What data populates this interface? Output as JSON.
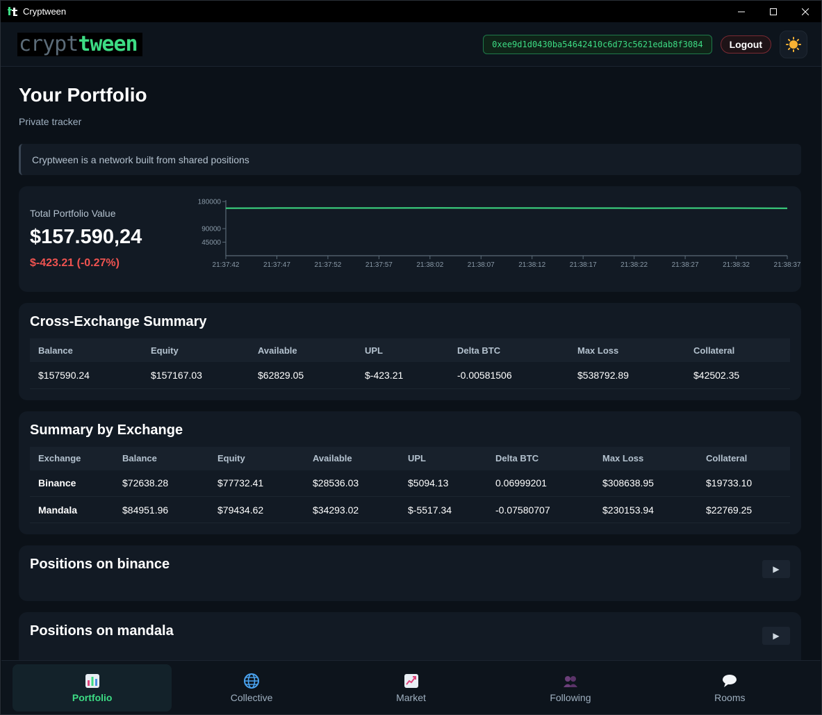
{
  "window": {
    "title": "Cryptween",
    "minimize": "—",
    "maximize": "☐",
    "close": "✕"
  },
  "header": {
    "logo_part1": "crypt",
    "logo_part2": "tween",
    "wallet": "0xee9d1d0430ba54642410c6d73c5621edab8f3084",
    "logout": "Logout"
  },
  "page": {
    "title": "Your Portfolio",
    "subtitle": "Private tracker",
    "banner": "Cryptween is a network built from shared positions"
  },
  "portfolio": {
    "label": "Total Portfolio Value",
    "value": "$157.590,24",
    "change": "$-423.21 (-0.27%)"
  },
  "chart_data": {
    "type": "line",
    "x": [
      "21:37:42",
      "21:37:47",
      "21:37:52",
      "21:37:57",
      "21:38:02",
      "21:38:07",
      "21:38:12",
      "21:38:17",
      "21:38:22",
      "21:38:27",
      "21:38:32",
      "21:38:37"
    ],
    "series": [
      {
        "values": [
          157800,
          158300,
          158500,
          158500,
          158600,
          158400,
          158300,
          158100,
          157900,
          158100,
          158200,
          157600
        ]
      }
    ],
    "yticks": [
      180000,
      90000,
      45000
    ],
    "ylim": [
      0,
      180000
    ],
    "line_color": "#3ddc84",
    "grid": false
  },
  "cross_exchange": {
    "title": "Cross-Exchange Summary",
    "headers": [
      "Balance",
      "Equity",
      "Available",
      "UPL",
      "Delta BTC",
      "Max Loss",
      "Collateral"
    ],
    "row": [
      "$157590.24",
      "$157167.03",
      "$62829.05",
      "$-423.21",
      "-0.00581506",
      "$538792.89",
      "$42502.35"
    ]
  },
  "by_exchange": {
    "title": "Summary by Exchange",
    "headers": [
      "Exchange",
      "Balance",
      "Equity",
      "Available",
      "UPL",
      "Delta BTC",
      "Max Loss",
      "Collateral"
    ],
    "rows": [
      [
        "Binance",
        "$72638.28",
        "$77732.41",
        "$28536.03",
        "$5094.13",
        "0.06999201",
        "$308638.95",
        "$19733.10"
      ],
      [
        "Mandala",
        "$84951.96",
        "$79434.62",
        "$34293.02",
        "$-5517.34",
        "-0.07580707",
        "$230153.94",
        "$22769.25"
      ]
    ]
  },
  "positions": [
    {
      "title": "Positions on binance",
      "toggle": "▶"
    },
    {
      "title": "Positions on mandala",
      "toggle": "▶"
    }
  ],
  "nav": [
    {
      "label": "Portfolio",
      "icon": "bar-chart-icon",
      "active": true
    },
    {
      "label": "Collective",
      "icon": "globe-icon",
      "active": false
    },
    {
      "label": "Market",
      "icon": "trend-chart-icon",
      "active": false
    },
    {
      "label": "Following",
      "icon": "people-icon",
      "active": false
    },
    {
      "label": "Rooms",
      "icon": "speech-bubble-icon",
      "active": false
    }
  ]
}
